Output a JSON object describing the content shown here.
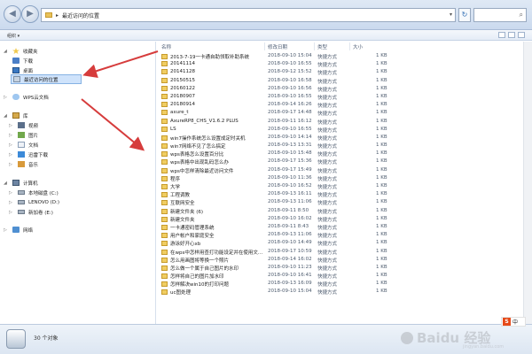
{
  "address_bar": {
    "crumbs": [
      "最近访问的位置"
    ],
    "refresh_icon": "refresh-icon",
    "search_icon": "search-icon"
  },
  "toolbar": {
    "organize_label": "组织 ▾"
  },
  "sidebar": {
    "favorites": {
      "label": "收藏夹",
      "items": [
        "下载",
        "桌面",
        "最近访问的位置"
      ]
    },
    "cloud": "WPS云文档",
    "libraries": {
      "label": "库",
      "items": [
        "视频",
        "图片",
        "文档",
        "迅雷下载",
        "音乐"
      ]
    },
    "computer": {
      "label": "计算机",
      "items": [
        "本地磁盘 (C:)",
        "LENOVO (D:)",
        "新加卷 (E:)"
      ]
    },
    "network": "网络"
  },
  "columns": {
    "name": "名称",
    "date": "修改日期",
    "type": "类型",
    "size": "大小"
  },
  "files": [
    {
      "name": "2013-7-19一卡通自助领取补助系统",
      "date": "2018-09-10 15:04",
      "type": "快捷方式",
      "size": "1 KB"
    },
    {
      "name": "20141114",
      "date": "2018-09-10 16:55",
      "type": "快捷方式",
      "size": "1 KB"
    },
    {
      "name": "20141128",
      "date": "2018-09-12 15:52",
      "type": "快捷方式",
      "size": "1 KB"
    },
    {
      "name": "20150515",
      "date": "2018-09-10 16:58",
      "type": "快捷方式",
      "size": "1 KB"
    },
    {
      "name": "20160122",
      "date": "2018-09-10 16:56",
      "type": "快捷方式",
      "size": "1 KB"
    },
    {
      "name": "20180907",
      "date": "2018-09-10 16:55",
      "type": "快捷方式",
      "size": "1 KB"
    },
    {
      "name": "20180914",
      "date": "2018-09-14 16:26",
      "type": "快捷方式",
      "size": "1 KB"
    },
    {
      "name": "axure_t",
      "date": "2018-09-17 14:48",
      "type": "快捷方式",
      "size": "1 KB"
    },
    {
      "name": "AxureRP8_CHS_V1.6.2 PLUS",
      "date": "2018-09-11 16:12",
      "type": "快捷方式",
      "size": "1 KB"
    },
    {
      "name": "LS",
      "date": "2018-09-10 16:55",
      "type": "快捷方式",
      "size": "1 KB"
    },
    {
      "name": "win7操作系统怎么设置成定时关机",
      "date": "2018-09-10 14:14",
      "type": "快捷方式",
      "size": "1 KB"
    },
    {
      "name": "win7网络不见了怎么搞定",
      "date": "2018-09-13 13:31",
      "type": "快捷方式",
      "size": "1 KB"
    },
    {
      "name": "wps表格怎么设置百分比",
      "date": "2018-09-10 15:48",
      "type": "快捷方式",
      "size": "1 KB"
    },
    {
      "name": "wps表格中出现乱码怎么办",
      "date": "2018-09-17 15:36",
      "type": "快捷方式",
      "size": "1 KB"
    },
    {
      "name": "wps中怎样清除最近访问文件",
      "date": "2018-09-17 15:49",
      "type": "快捷方式",
      "size": "1 KB"
    },
    {
      "name": "程序",
      "date": "2018-09-10 11:36",
      "type": "快捷方式",
      "size": "1 KB"
    },
    {
      "name": "大学",
      "date": "2018-09-10 16:52",
      "type": "快捷方式",
      "size": "1 KB"
    },
    {
      "name": "工程调教",
      "date": "2018-09-13 16:11",
      "type": "快捷方式",
      "size": "1 KB"
    },
    {
      "name": "互联网安全",
      "date": "2018-09-13 11:06",
      "type": "快捷方式",
      "size": "1 KB"
    },
    {
      "name": "新建文件夹 (6)",
      "date": "2018-09-11 8:50",
      "type": "快捷方式",
      "size": "1 KB"
    },
    {
      "name": "新建文件夹",
      "date": "2018-09-10 16:02",
      "type": "快捷方式",
      "size": "1 KB"
    },
    {
      "name": "一卡通密码管理系统",
      "date": "2018-09-11 8:43",
      "type": "快捷方式",
      "size": "1 KB"
    },
    {
      "name": "用户帐户和家庭安全",
      "date": "2018-09-13 11:06",
      "type": "快捷方式",
      "size": "1 KB"
    },
    {
      "name": "游泳好开心xb",
      "date": "2018-09-10 14:49",
      "type": "快捷方式",
      "size": "1 KB"
    },
    {
      "name": "在wps中怎样用查打功能设定并在使用文...",
      "date": "2018-09-17 10:59",
      "type": "快捷方式",
      "size": "1 KB"
    },
    {
      "name": "怎么用画图将等换一个照片",
      "date": "2018-09-14 16:02",
      "type": "快捷方式",
      "size": "1 KB"
    },
    {
      "name": "怎么做一个属于自己图片的水印",
      "date": "2018-09-10 11:23",
      "type": "快捷方式",
      "size": "1 KB"
    },
    {
      "name": "怎样将自己的图片加水印",
      "date": "2018-09-10 16:41",
      "type": "快捷方式",
      "size": "1 KB"
    },
    {
      "name": "怎样解决win10的打印问题",
      "date": "2018-09-13 16:09",
      "type": "快捷方式",
      "size": "1 KB"
    },
    {
      "name": "uc图处理",
      "date": "2018-09-10 15:04",
      "type": "快捷方式",
      "size": "1 KB"
    }
  ],
  "status": {
    "count_text": "30 个对象"
  },
  "ime": {
    "badge": "S",
    "label": "中"
  },
  "watermark": {
    "text": "Baidu 经验",
    "sub": "jingyan.baidu.com"
  },
  "colors": {
    "arrow": "#d63c3c",
    "selection": "#cfe3fb",
    "folder": "#f0cd62"
  }
}
